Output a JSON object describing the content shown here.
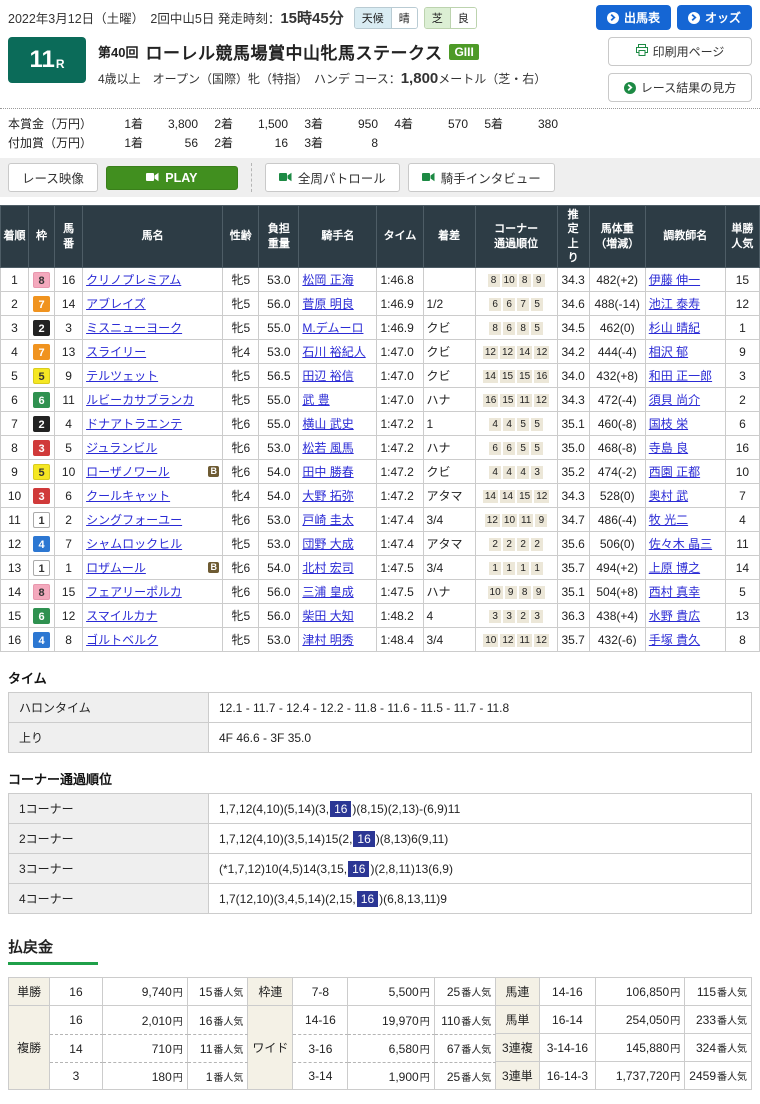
{
  "topbar": {
    "date_text": "2022年3月12日（土曜）　2回中山5日",
    "start_label": "発走時刻：",
    "start_time": "15時45分",
    "weather": {
      "label": "天候",
      "value": "晴"
    },
    "track": {
      "label": "芝",
      "value": "良"
    },
    "buttons": [
      {
        "label": "出馬表",
        "icon": "arrow-circle-icon"
      },
      {
        "label": "オッズ",
        "icon": "arrow-circle-icon"
      }
    ]
  },
  "race": {
    "number": "11",
    "r": "R",
    "round": "第40回",
    "title": "ローレル競馬場賞中山牝馬ステークス",
    "grade": "GIII",
    "conditions": "4歳以上　オープン（国際）牝（特指）　ハンデ",
    "course_label": "コース：",
    "course_value": "1,800",
    "course_suffix": "メートル（芝・右）",
    "side_buttons": [
      {
        "label": "印刷用ページ",
        "icon": "printer-icon"
      },
      {
        "label": "レース結果の見方",
        "icon": "arrow-circle-icon"
      }
    ]
  },
  "prize": {
    "rows": [
      {
        "label": "本賞金（万円）",
        "pairs": [
          [
            "1着",
            "3,800"
          ],
          [
            "2着",
            "1,500"
          ],
          [
            "3着",
            "950"
          ],
          [
            "4着",
            "570"
          ],
          [
            "5着",
            "380"
          ]
        ]
      },
      {
        "label": "付加賞（万円）",
        "pairs": [
          [
            "1着",
            "56"
          ],
          [
            "2着",
            "16"
          ],
          [
            "3着",
            "8"
          ]
        ]
      }
    ]
  },
  "video": {
    "race_video_label": "レース映像",
    "play_label": "PLAY",
    "patrol_label": "全周パトロール",
    "interview_label": "騎手インタビュー",
    "play_icon": "video-camera-icon"
  },
  "frame_colors": {
    "1": {
      "bg": "#ffffff",
      "fg": "#333333",
      "bd": "#aaaaaa"
    },
    "2": {
      "bg": "#222222",
      "fg": "#ffffff",
      "bd": "#222222"
    },
    "3": {
      "bg": "#d03a3a",
      "fg": "#ffffff",
      "bd": "#d03a3a"
    },
    "4": {
      "bg": "#2c77d2",
      "fg": "#ffffff",
      "bd": "#2c77d2"
    },
    "5": {
      "bg": "#f5e723",
      "fg": "#333333",
      "bd": "#d9cc1e"
    },
    "6": {
      "bg": "#2f9150",
      "fg": "#ffffff",
      "bd": "#2f9150"
    },
    "7": {
      "bg": "#f0931f",
      "fg": "#ffffff",
      "bd": "#f0931f"
    },
    "8": {
      "bg": "#f4a9bd",
      "fg": "#333333",
      "bd": "#e898ae"
    }
  },
  "results": {
    "blinker_label": "B",
    "columns": [
      {
        "lines": [
          "着順"
        ]
      },
      {
        "lines": [
          "枠"
        ]
      },
      {
        "lines": [
          "馬",
          "番"
        ]
      },
      {
        "lines": [
          "馬名"
        ]
      },
      {
        "lines": [
          "性齢"
        ]
      },
      {
        "lines": [
          "負担",
          "重量"
        ]
      },
      {
        "lines": [
          "騎手名"
        ]
      },
      {
        "lines": [
          "タイム"
        ]
      },
      {
        "lines": [
          "着差"
        ]
      },
      {
        "lines": [
          "コーナー",
          "通過順位"
        ]
      },
      {
        "lines": [
          "推",
          "定",
          "上",
          "り"
        ]
      },
      {
        "lines": [
          "馬体重",
          "（増減）"
        ]
      },
      {
        "lines": [
          "調教師名"
        ]
      },
      {
        "lines": [
          "単勝",
          "人気"
        ]
      }
    ],
    "rows": [
      {
        "order": "1",
        "frame": "8",
        "num": "16",
        "name": "クリノプレミアム",
        "b": false,
        "sexage": "牝5",
        "weight": "53.0",
        "jockey": "松岡 正海",
        "time": "1:46.8",
        "margin": "",
        "corners": [
          "8",
          "10",
          "8",
          "9"
        ],
        "agari": "34.3",
        "hweight": "482(+2)",
        "trainer": "伊藤 伸一",
        "pop": "15"
      },
      {
        "order": "2",
        "frame": "7",
        "num": "14",
        "name": "アブレイズ",
        "b": false,
        "sexage": "牝5",
        "weight": "56.0",
        "jockey": "菅原 明良",
        "time": "1:46.9",
        "margin": "1/2",
        "corners": [
          "6",
          "6",
          "7",
          "5"
        ],
        "agari": "34.6",
        "hweight": "488(-14)",
        "trainer": "池江 泰寿",
        "pop": "12"
      },
      {
        "order": "3",
        "frame": "2",
        "num": "3",
        "name": "ミスニューヨーク",
        "b": false,
        "sexage": "牝5",
        "weight": "55.0",
        "jockey": "M.デムーロ",
        "time": "1:46.9",
        "margin": "クビ",
        "corners": [
          "8",
          "6",
          "8",
          "5"
        ],
        "agari": "34.5",
        "hweight": "462(0)",
        "trainer": "杉山 晴紀",
        "pop": "1"
      },
      {
        "order": "4",
        "frame": "7",
        "num": "13",
        "name": "スライリー",
        "b": false,
        "sexage": "牝4",
        "weight": "53.0",
        "jockey": "石川 裕紀人",
        "time": "1:47.0",
        "margin": "クビ",
        "corners": [
          "12",
          "12",
          "14",
          "12"
        ],
        "agari": "34.2",
        "hweight": "444(-4)",
        "trainer": "相沢 郁",
        "pop": "9"
      },
      {
        "order": "5",
        "frame": "5",
        "num": "9",
        "name": "テルツェット",
        "b": false,
        "sexage": "牝5",
        "weight": "56.5",
        "jockey": "田辺 裕信",
        "time": "1:47.0",
        "margin": "クビ",
        "corners": [
          "14",
          "15",
          "15",
          "16"
        ],
        "agari": "34.0",
        "hweight": "432(+8)",
        "trainer": "和田 正一郎",
        "pop": "3"
      },
      {
        "order": "6",
        "frame": "6",
        "num": "11",
        "name": "ルビーカサブランカ",
        "b": false,
        "sexage": "牝5",
        "weight": "55.0",
        "jockey": "武 豊",
        "time": "1:47.0",
        "margin": "ハナ",
        "corners": [
          "16",
          "15",
          "11",
          "12"
        ],
        "agari": "34.3",
        "hweight": "472(-4)",
        "trainer": "須貝 尚介",
        "pop": "2"
      },
      {
        "order": "7",
        "frame": "2",
        "num": "4",
        "name": "ドナアトラエンテ",
        "b": false,
        "sexage": "牝6",
        "weight": "55.0",
        "jockey": "横山 武史",
        "time": "1:47.2",
        "margin": "1",
        "corners": [
          "4",
          "4",
          "5",
          "5"
        ],
        "agari": "35.1",
        "hweight": "460(-8)",
        "trainer": "国枝 栄",
        "pop": "6"
      },
      {
        "order": "8",
        "frame": "3",
        "num": "5",
        "name": "ジュランビル",
        "b": false,
        "sexage": "牝6",
        "weight": "53.0",
        "jockey": "松若 風馬",
        "time": "1:47.2",
        "margin": "ハナ",
        "corners": [
          "6",
          "6",
          "5",
          "5"
        ],
        "agari": "35.0",
        "hweight": "468(-8)",
        "trainer": "寺島 良",
        "pop": "16"
      },
      {
        "order": "9",
        "frame": "5",
        "num": "10",
        "name": "ローザノワール",
        "b": true,
        "sexage": "牝6",
        "weight": "54.0",
        "jockey": "田中 勝春",
        "time": "1:47.2",
        "margin": "クビ",
        "corners": [
          "4",
          "4",
          "4",
          "3"
        ],
        "agari": "35.2",
        "hweight": "474(-2)",
        "trainer": "西園 正都",
        "pop": "10"
      },
      {
        "order": "10",
        "frame": "3",
        "num": "6",
        "name": "クールキャット",
        "b": false,
        "sexage": "牝4",
        "weight": "54.0",
        "jockey": "大野 拓弥",
        "time": "1:47.2",
        "margin": "アタマ",
        "corners": [
          "14",
          "14",
          "15",
          "12"
        ],
        "agari": "34.3",
        "hweight": "528(0)",
        "trainer": "奥村 武",
        "pop": "7"
      },
      {
        "order": "11",
        "frame": "1",
        "num": "2",
        "name": "シングフォーユー",
        "b": false,
        "sexage": "牝6",
        "weight": "53.0",
        "jockey": "戸崎 圭太",
        "time": "1:47.4",
        "margin": "3/4",
        "corners": [
          "12",
          "10",
          "11",
          "9"
        ],
        "agari": "34.7",
        "hweight": "486(-4)",
        "trainer": "牧 光二",
        "pop": "4"
      },
      {
        "order": "12",
        "frame": "4",
        "num": "7",
        "name": "シャムロックヒル",
        "b": false,
        "sexage": "牝5",
        "weight": "53.0",
        "jockey": "団野 大成",
        "time": "1:47.4",
        "margin": "アタマ",
        "corners": [
          "2",
          "2",
          "2",
          "2"
        ],
        "agari": "35.6",
        "hweight": "506(0)",
        "trainer": "佐々木 晶三",
        "pop": "11"
      },
      {
        "order": "13",
        "frame": "1",
        "num": "1",
        "name": "ロザムール",
        "b": true,
        "sexage": "牝6",
        "weight": "54.0",
        "jockey": "北村 宏司",
        "time": "1:47.5",
        "margin": "3/4",
        "corners": [
          "1",
          "1",
          "1",
          "1"
        ],
        "agari": "35.7",
        "hweight": "494(+2)",
        "trainer": "上原 博之",
        "pop": "14"
      },
      {
        "order": "14",
        "frame": "8",
        "num": "15",
        "name": "フェアリーポルカ",
        "b": false,
        "sexage": "牝6",
        "weight": "56.0",
        "jockey": "三浦 皇成",
        "time": "1:47.5",
        "margin": "ハナ",
        "corners": [
          "10",
          "9",
          "8",
          "9"
        ],
        "agari": "35.1",
        "hweight": "504(+8)",
        "trainer": "西村 真幸",
        "pop": "5"
      },
      {
        "order": "15",
        "frame": "6",
        "num": "12",
        "name": "スマイルカナ",
        "b": false,
        "sexage": "牝5",
        "weight": "56.0",
        "jockey": "柴田 大知",
        "time": "1:48.2",
        "margin": "4",
        "corners": [
          "3",
          "3",
          "2",
          "3"
        ],
        "agari": "36.3",
        "hweight": "438(+4)",
        "trainer": "水野 貴広",
        "pop": "13"
      },
      {
        "order": "16",
        "frame": "4",
        "num": "8",
        "name": "ゴルトベルク",
        "b": false,
        "sexage": "牝5",
        "weight": "53.0",
        "jockey": "津村 明秀",
        "time": "1:48.4",
        "margin": "3/4",
        "corners": [
          "10",
          "12",
          "11",
          "12"
        ],
        "agari": "35.7",
        "hweight": "432(-6)",
        "trainer": "手塚 貴久",
        "pop": "8"
      }
    ]
  },
  "time_section": {
    "heading": "タイム",
    "rows": [
      {
        "label": "ハロンタイム",
        "value": "12.1 - 11.7 - 12.4 - 12.2 - 11.8 - 11.6 - 11.5 - 11.7 - 11.8"
      },
      {
        "label": "上り",
        "value": "4F 46.6 - 3F 35.0"
      }
    ]
  },
  "corner_section": {
    "heading": "コーナー通過順位",
    "rows": [
      {
        "label": "1コーナー",
        "before": "1,7,12(4,10)(5,14)(3,",
        "highlight": "16",
        "after": ")(8,15)(2,13)-(6,9)11"
      },
      {
        "label": "2コーナー",
        "before": "1,7,12(4,10)(3,5,14)15(2,",
        "highlight": "16",
        "after": ")(8,13)6(9,11)"
      },
      {
        "label": "3コーナー",
        "before": "(*1,7,12)10(4,5)14(3,15,",
        "highlight": "16",
        "after": ")(2,8,11)13(6,9)"
      },
      {
        "label": "4コーナー",
        "before": "1,7(12,10)(3,4,5,14)(2,15,",
        "highlight": "16",
        "after": ")(6,8,13,11)9"
      }
    ]
  },
  "payout": {
    "heading": "払戻金",
    "yen": "円",
    "ninki": "番人気",
    "tansho": {
      "label": "単勝",
      "combo": "16",
      "amount": "9,740",
      "pop": "15"
    },
    "fukusho": {
      "label": "複勝",
      "rows": [
        {
          "combo": "16",
          "amount": "2,010",
          "pop": "16"
        },
        {
          "combo": "14",
          "amount": "710",
          "pop": "11"
        },
        {
          "combo": "3",
          "amount": "180",
          "pop": "1"
        }
      ]
    },
    "wakuren": {
      "label": "枠連",
      "combo": "7-8",
      "amount": "5,500",
      "pop": "25"
    },
    "wide": {
      "label": "ワイド",
      "rows": [
        {
          "combo": "14-16",
          "amount": "19,970",
          "pop": "110"
        },
        {
          "combo": "3-16",
          "amount": "6,580",
          "pop": "67"
        },
        {
          "combo": "3-14",
          "amount": "1,900",
          "pop": "25"
        }
      ]
    },
    "umaren": {
      "label": "馬連",
      "combo": "14-16",
      "amount": "106,850",
      "pop": "115"
    },
    "umatan": {
      "label": "馬単",
      "combo": "16-14",
      "amount": "254,050",
      "pop": "233"
    },
    "sanrenpuku": {
      "label": "3連複",
      "combo": "3-14-16",
      "amount": "145,880",
      "pop": "324"
    },
    "sanrentan": {
      "label": "3連単",
      "combo": "16-14-3",
      "amount": "1,737,720",
      "pop": "2459"
    }
  }
}
